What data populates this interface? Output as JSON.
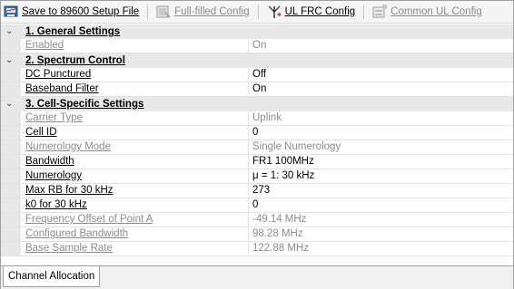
{
  "toolbar": {
    "save_label": "Save to 89600 Setup File",
    "fullfilled_label": "Full-filled Config",
    "ul_frc_label": "UL FRC Config",
    "common_ul_label": "Common UL Config"
  },
  "sections": [
    {
      "toggle": "⌄",
      "title": "1. General Settings",
      "rows": [
        {
          "name": "Enabled",
          "value": "On"
        }
      ]
    },
    {
      "toggle": "⌄",
      "title": "2. Spectrum Control",
      "rows": [
        {
          "name": "DC Punctured",
          "value": "Off"
        },
        {
          "name": "Baseband Filter",
          "value": "On"
        }
      ]
    },
    {
      "toggle": "⌄",
      "title": "3. Cell-Specific Settings",
      "rows": [
        {
          "name": "Carrier Type",
          "value": "Uplink"
        },
        {
          "name": "Cell ID",
          "value": "0"
        },
        {
          "name": "Numerology Mode",
          "value": "Single Numerology"
        },
        {
          "name": "Bandwidth",
          "value": "FR1 100MHz"
        },
        {
          "name": "Numerology",
          "value": "μ = 1: 30 kHz"
        },
        {
          "name": "Max RB for 30 kHz",
          "value": "273"
        },
        {
          "name": "k0 for 30 kHz",
          "value": "0"
        },
        {
          "name": "Frequency Offset of Point A",
          "value": "-49.14 MHz"
        },
        {
          "name": "Configured Bandwidth",
          "value": "98.28 MHz"
        },
        {
          "name": "Base Sample Rate",
          "value": "122.88 MHz"
        }
      ]
    }
  ],
  "tabs": [
    {
      "label": "Channel Allocation"
    }
  ]
}
